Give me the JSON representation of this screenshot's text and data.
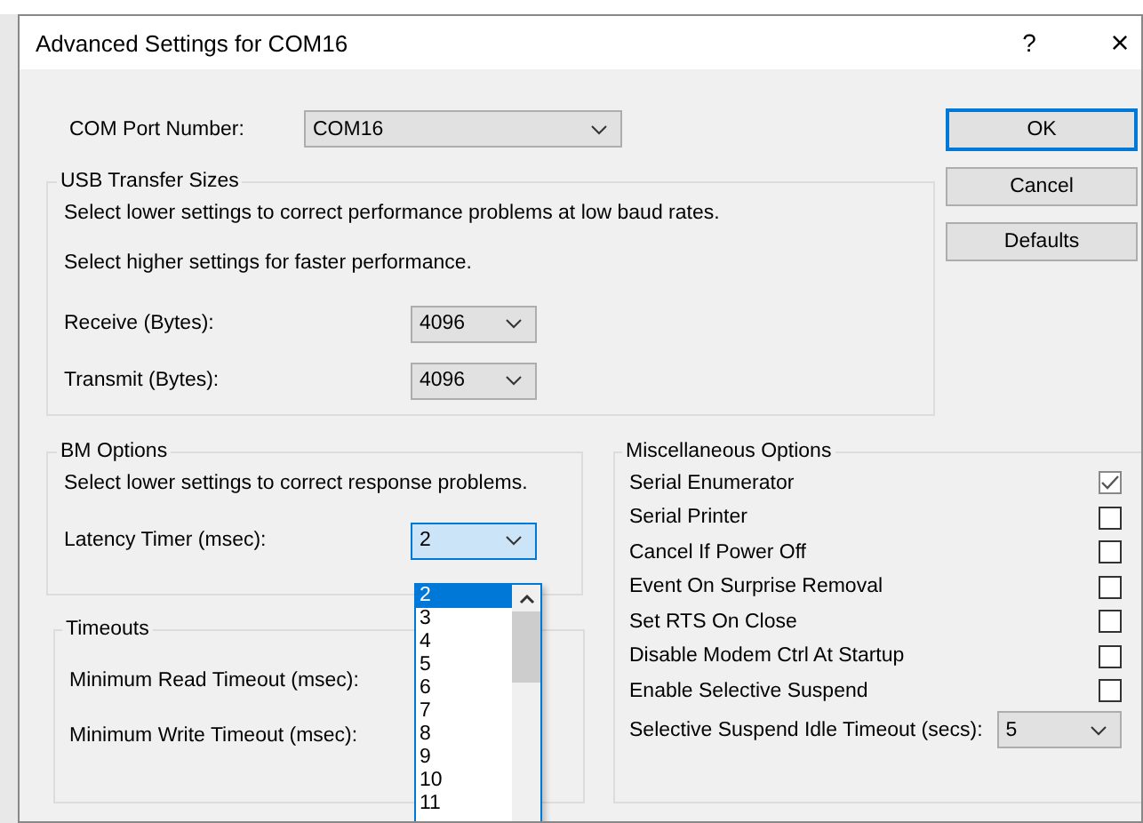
{
  "dialog": {
    "title": "Advanced Settings for COM16",
    "help": "?",
    "close": "×"
  },
  "com_port": {
    "label": "COM Port Number:",
    "value": "COM16"
  },
  "usb_transfer_sizes": {
    "title": "USB Transfer Sizes",
    "notes": [
      "Select lower settings to correct performance problems at low baud rates.",
      "Select higher settings for faster performance."
    ],
    "fields": [
      {
        "label": "Receive (Bytes):",
        "value": "4096"
      },
      {
        "label": "Transmit (Bytes):",
        "value": "4096"
      }
    ]
  },
  "bm_options": {
    "title": "BM Options",
    "note": "Select lower settings to correct response problems.",
    "latency": {
      "label": "Latency Timer (msec):",
      "value": "2",
      "focused": true
    }
  },
  "timeouts": {
    "title": "Timeouts",
    "fields": [
      "Minimum Read Timeout (msec):",
      "Minimum Write Timeout (msec):"
    ]
  },
  "misc": {
    "title": "Miscellaneous Options",
    "options": [
      {
        "label": "Serial Enumerator",
        "checked": true
      },
      {
        "label": "Serial Printer",
        "checked": false
      },
      {
        "label": "Cancel If Power Off",
        "checked": false
      },
      {
        "label": "Event On Surprise Removal",
        "checked": false
      },
      {
        "label": "Set RTS On Close",
        "checked": false
      },
      {
        "label": "Disable Modem Ctrl At Startup",
        "checked": false
      },
      {
        "label": "Enable Selective Suspend",
        "checked": false
      }
    ],
    "idle_timeout": {
      "label": "Selective Suspend Idle Timeout (secs):",
      "value": "5"
    }
  },
  "buttons": [
    {
      "label": "OK",
      "default": true
    },
    {
      "label": "Cancel",
      "default": false
    },
    {
      "label": "Defaults",
      "default": false
    }
  ],
  "latency_list": {
    "items": [
      {
        "label": "2",
        "selected": true
      },
      {
        "label": "3",
        "selected": false
      },
      {
        "label": "4",
        "selected": false
      },
      {
        "label": "5",
        "selected": false
      },
      {
        "label": "6",
        "selected": false
      },
      {
        "label": "7",
        "selected": false
      },
      {
        "label": "8",
        "selected": false
      },
      {
        "label": "9",
        "selected": false
      },
      {
        "label": "10",
        "selected": false
      },
      {
        "label": "11",
        "selected": false
      }
    ]
  }
}
